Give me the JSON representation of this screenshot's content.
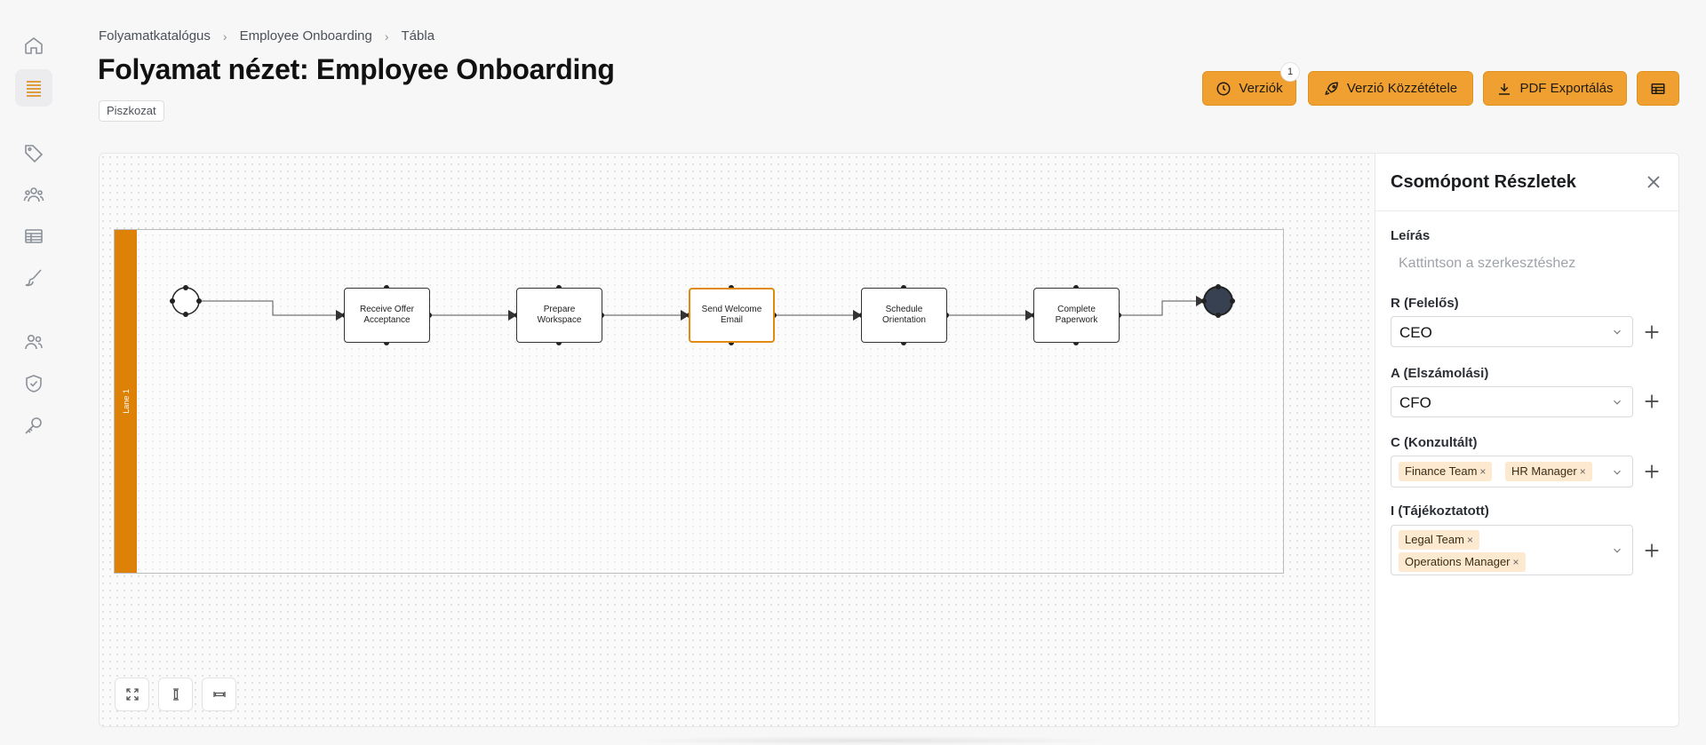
{
  "breadcrumb": [
    "Folyamatkatalógus",
    "Employee Onboarding",
    "Tábla"
  ],
  "page": {
    "title": "Folyamat nézet: Employee Onboarding",
    "status": "Piszkozat"
  },
  "toolbar": {
    "versions_label": "Verziók",
    "versions_count": "1",
    "publish_label": "Verzió Közzététele",
    "export_label": "PDF Exportálás"
  },
  "diagram": {
    "lane_label": "Lane 1",
    "tasks": [
      "Receive Offer Acceptance",
      "Prepare Workspace",
      "Send Welcome Email",
      "Schedule Orientation",
      "Complete Paperwork"
    ],
    "selected_task": "Send Welcome Email"
  },
  "panel": {
    "title": "Csomópont Részletek",
    "description_label": "Leírás",
    "description_placeholder": "Kattintson a szerkesztéshez",
    "r_label": "R (Felelős)",
    "r_value": "CEO",
    "a_label": "A (Elszámolási)",
    "a_value": "CFO",
    "c_label": "C (Konzultált)",
    "c_tags": [
      "Finance Team",
      "HR Manager"
    ],
    "i_label": "I (Tájékoztatott)",
    "i_tags": [
      "Legal Team",
      "Operations Manager"
    ]
  },
  "colors": {
    "accent": "#f0a030",
    "lane": "#de8207",
    "selected": "#e08a10"
  },
  "icons": [
    "home-icon",
    "list-icon",
    "tag-icon",
    "team-icon",
    "table-icon",
    "brush-icon",
    "users-icon",
    "shield-check-icon",
    "key-icon",
    "clock-icon",
    "rocket-icon",
    "download-icon",
    "table-view-icon",
    "close-icon",
    "chevron-down-icon",
    "plus-icon",
    "fit-view-icon",
    "fit-height-icon",
    "fit-width-icon"
  ]
}
